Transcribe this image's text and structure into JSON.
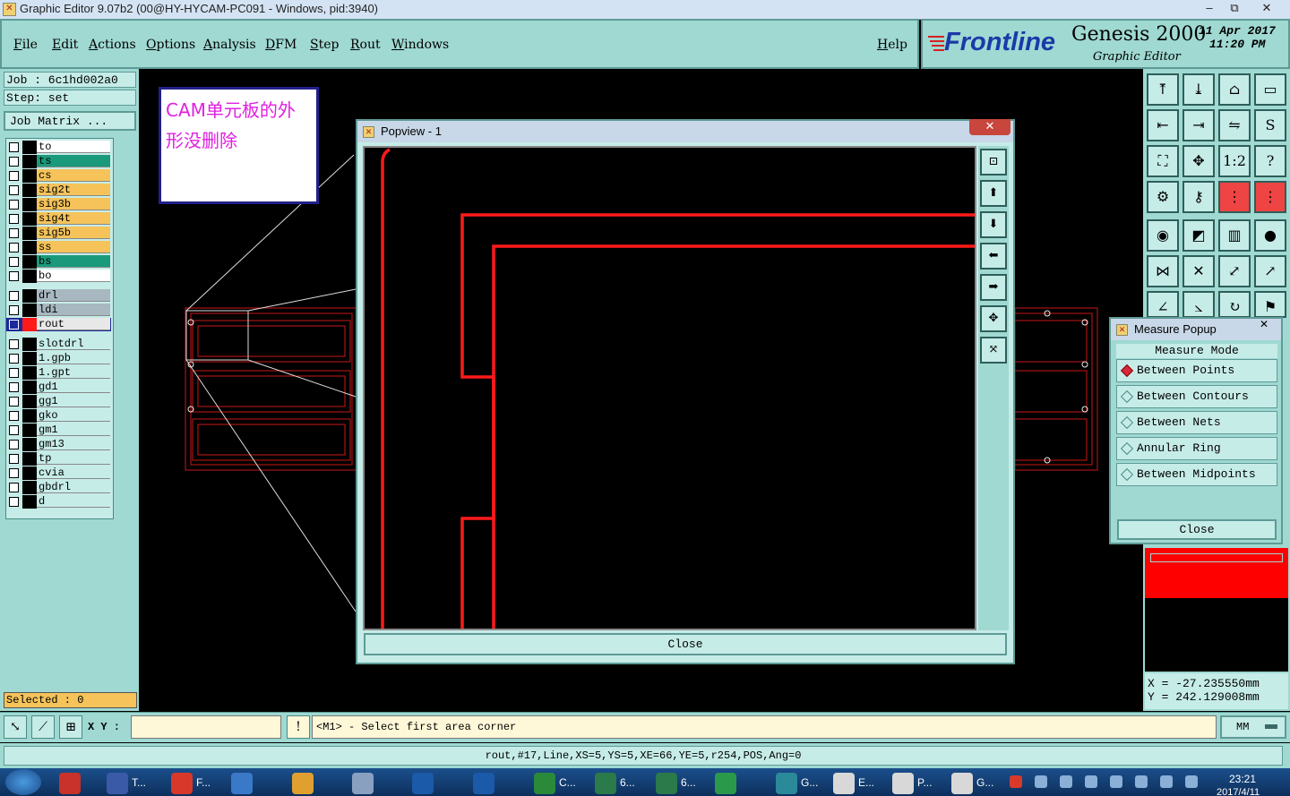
{
  "window": {
    "title": "Graphic Editor 9.07b2 (00@HY-HYCAM-PC091 - Windows, pid:3940)",
    "minimize": "–",
    "maximize": "⧉",
    "close": "✕"
  },
  "menu": {
    "items": [
      "File",
      "Edit",
      "Actions",
      "Options",
      "Analysis",
      "DFM",
      "Step",
      "Rout",
      "Windows"
    ],
    "help": "Help"
  },
  "brand": {
    "logo": "Frontline",
    "product": "Genesis 2000",
    "subtitle": "Graphic Editor",
    "date": "11 Apr 2017",
    "time": "11:20 PM"
  },
  "left": {
    "job": "Job  :  6c1hd002a0",
    "step": "Step:  set",
    "job_matrix": "Job Matrix ...",
    "selected": "Selected : 0"
  },
  "layers": [
    {
      "name": "to",
      "color": "#ffffff"
    },
    {
      "name": "ts",
      "color": "#1a9a7a"
    },
    {
      "name": "cs",
      "color": "#f5c35a"
    },
    {
      "name": "sig2t",
      "color": "#f5c35a"
    },
    {
      "name": "sig3b",
      "color": "#f5c35a"
    },
    {
      "name": "sig4t",
      "color": "#f5c35a"
    },
    {
      "name": "sig5b",
      "color": "#f5c35a"
    },
    {
      "name": "ss",
      "color": "#f5c35a"
    },
    {
      "name": "bs",
      "color": "#1a9a7a"
    },
    {
      "name": "bo",
      "color": "#ffffff"
    },
    {
      "name": "drl",
      "color": "#a8b8c0"
    },
    {
      "name": "ldi",
      "color": "#a8b8c0"
    },
    {
      "name": "rout",
      "color": "#e8e8e8"
    },
    {
      "name": "slotdrl",
      "color": "#c6ece8"
    },
    {
      "name": "1.gpb",
      "color": "#c6ece8"
    },
    {
      "name": "1.gpt",
      "color": "#c6ece8"
    },
    {
      "name": "gd1",
      "color": "#c6ece8"
    },
    {
      "name": "gg1",
      "color": "#c6ece8"
    },
    {
      "name": "gko",
      "color": "#c6ece8"
    },
    {
      "name": "gm1",
      "color": "#c6ece8"
    },
    {
      "name": "gm13",
      "color": "#c6ece8"
    },
    {
      "name": "tp",
      "color": "#c6ece8"
    },
    {
      "name": "cvia",
      "color": "#c6ece8"
    },
    {
      "name": "gbdrl",
      "color": "#c6ece8"
    },
    {
      "name": "d",
      "color": "#c6ece8"
    }
  ],
  "annotation": {
    "line1": "CAM单元板的外",
    "line2": "形没删除"
  },
  "popview": {
    "title": "Popview - 1",
    "close": "Close"
  },
  "measure": {
    "title": "Measure Popup",
    "mode_label": "Measure Mode",
    "options": [
      "Between Points",
      "Between Contours",
      "Between Nets",
      "Annular Ring",
      "Between Midpoints"
    ],
    "selected_option": "Between Points",
    "close": "Close"
  },
  "coords": {
    "x": "X  =  -27.235550mm",
    "y": "Y  =  242.129008mm"
  },
  "status": {
    "xy_label": "X Y :",
    "prompt": "<M1> - Select first area corner",
    "units": "MM",
    "info": "rout,#17,Line,XS=5,YS=5,XE=66,YE=5,r254,POS,Ang=0"
  },
  "taskbar": {
    "items": [
      "T...",
      "F...",
      "",
      "",
      "",
      "",
      "C...",
      "6...",
      "6...",
      "",
      "G...",
      "E...",
      "P...",
      "G..."
    ],
    "clock_time": "23:21",
    "clock_date": "2017/4/11"
  },
  "colors": {
    "panel": "#9fd9d2",
    "panel_light": "#c6ece8",
    "rout_red": "#ff1a1a",
    "annotation_text": "#e020e0"
  }
}
